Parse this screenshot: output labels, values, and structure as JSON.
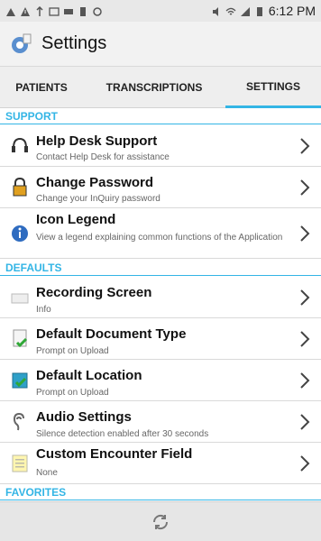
{
  "status_bar": {
    "time": "6:12 PM"
  },
  "appbar": {
    "title": "Settings"
  },
  "tabs": [
    {
      "label": "PATIENTS",
      "selected": false
    },
    {
      "label": "TRANSCRIPTIONS",
      "selected": false
    },
    {
      "label": "SETTINGS",
      "selected": true
    }
  ],
  "sections": [
    {
      "label": "SUPPORT"
    },
    {
      "label": "DEFAULTS"
    },
    {
      "label": "FAVORITES"
    }
  ],
  "items": [
    {
      "title": "Help Desk Support",
      "subtitle": "Contact Help Desk for assistance",
      "icon": "headset-icon"
    },
    {
      "title": "Change Password",
      "subtitle": "Change your InQuiry password",
      "icon": "lock-icon"
    },
    {
      "title": "Icon Legend",
      "subtitle": "View a legend explaining common functions of the Application",
      "icon": "info-icon"
    },
    {
      "title": "Recording Screen",
      "subtitle": "Info",
      "icon": "keyboard-icon"
    },
    {
      "title": "Default Document Type",
      "subtitle": "Prompt on Upload",
      "icon": "document-check-icon"
    },
    {
      "title": "Default Location",
      "subtitle": "Prompt on Upload",
      "icon": "location-check-icon"
    },
    {
      "title": "Audio Settings",
      "subtitle": "Silence detection enabled after 30 seconds",
      "icon": "ear-icon"
    },
    {
      "title": "Custom Encounter Field",
      "subtitle": "None",
      "icon": "notepad-icon"
    }
  ],
  "colors": {
    "accent": "#33b5e5",
    "tab_bg": "#eeeeee",
    "appbar_bg": "#f2f2f2"
  }
}
